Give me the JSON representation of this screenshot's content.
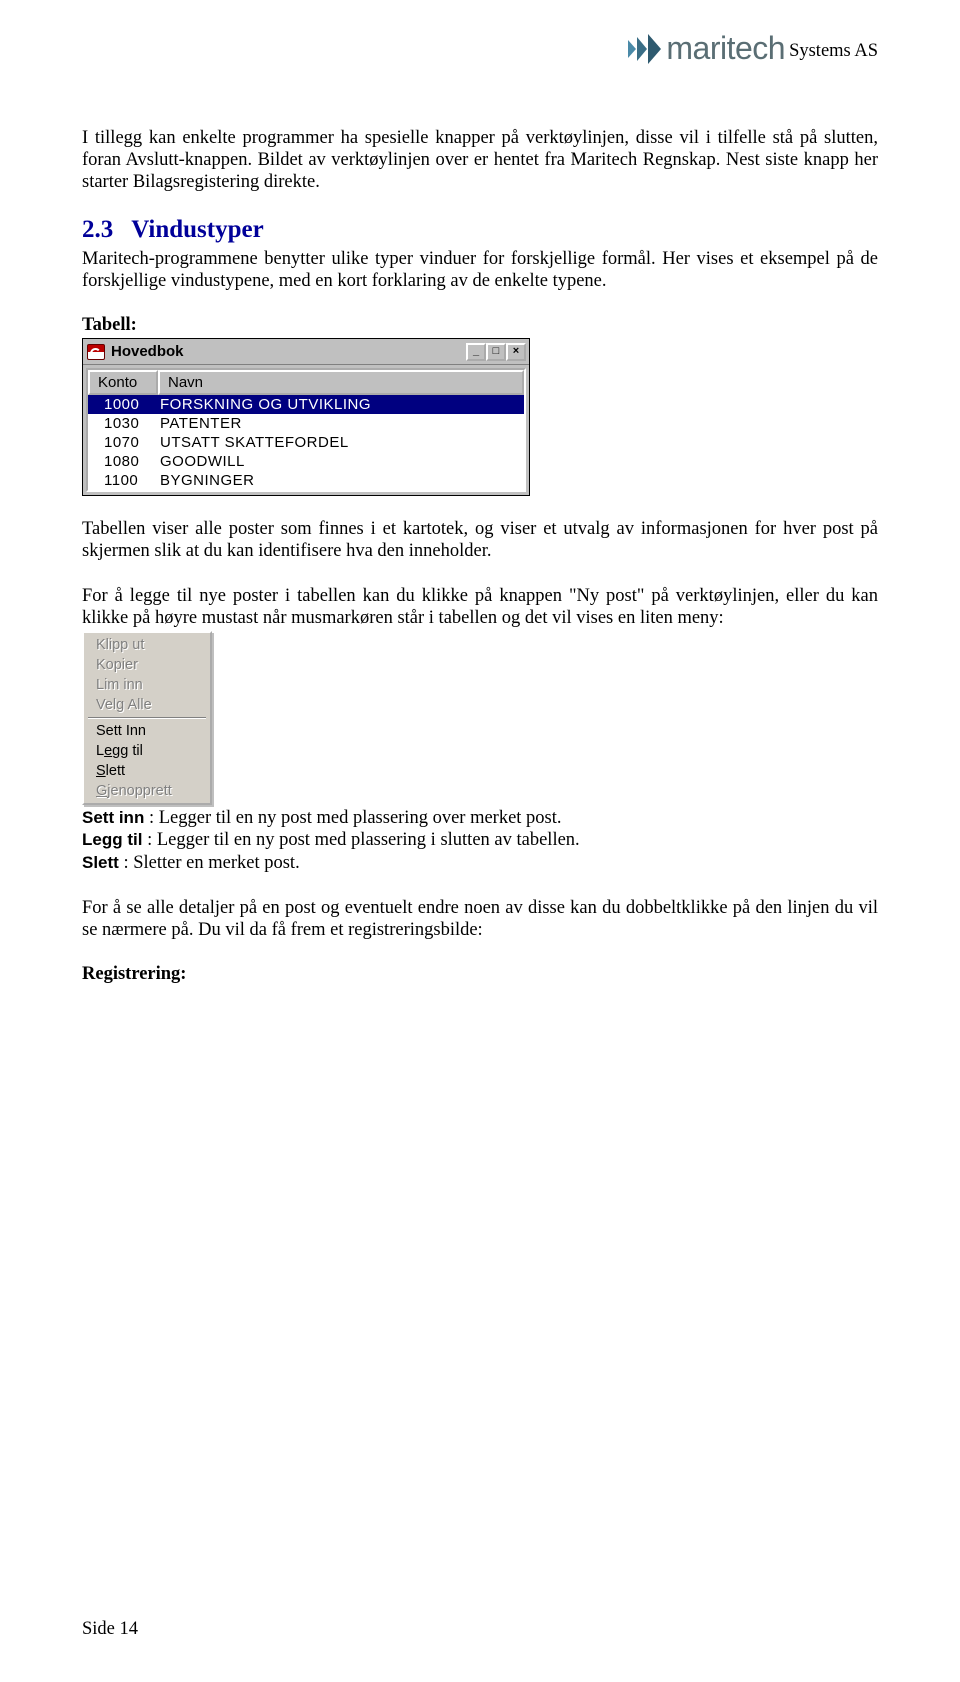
{
  "header": {
    "brand_text": "maritech",
    "brand_suffix": "Systems AS"
  },
  "para1": "I tillegg kan enkelte programmer ha spesielle knapper på verktøylinjen, disse vil i tilfelle stå på slutten, foran Avslutt-knappen. Bildet av verktøylinjen over er hentet fra Maritech Regnskap. Nest siste knapp her starter Bilagsregistering direkte.",
  "section": {
    "num": "2.3",
    "title": "Vindustyper"
  },
  "para2": "Maritech-programmene benytter ulike typer vinduer for forskjellige formål. Her vises et eksempel på de forskjellige vindustypene, med en kort forklaring av de enkelte typene.",
  "tabell_label": "Tabell:",
  "hovedbok": {
    "title": "Hovedbok",
    "col_konto": "Konto",
    "col_navn": "Navn",
    "rows": [
      {
        "konto": "1000",
        "navn": "FORSKNING OG UTVIKLING",
        "selected": true
      },
      {
        "konto": "1030",
        "navn": "PATENTER",
        "selected": false
      },
      {
        "konto": "1070",
        "navn": "UTSATT SKATTEFORDEL",
        "selected": false
      },
      {
        "konto": "1080",
        "navn": "GOODWILL",
        "selected": false
      },
      {
        "konto": "1100",
        "navn": "BYGNINGER",
        "selected": false
      }
    ],
    "minbtn": "_",
    "maxbtn": "□",
    "closebtn": "×"
  },
  "para3": "Tabellen viser alle poster som finnes i et kartotek, og viser et utvalg av informasjonen for hver post på skjermen slik at du kan identifisere hva den inneholder.",
  "para4": "For å legge til nye poster i tabellen kan du klikke på knappen \"Ny post\" på verktøylinjen, eller du kan klikke på høyre mustast når musmarkøren står i tabellen og det vil vises en liten meny:",
  "menu": {
    "klipp_ut": "Klipp ut",
    "kopier": "Kopier",
    "lim_inn": "Lim inn",
    "velg_alle": "Velg Alle",
    "sett_inn": "Sett Inn",
    "legg_til": "Legg til",
    "slett": "Slett",
    "gjenopprett": "Gjenopprett"
  },
  "defs": {
    "sett_inn_label": "Sett inn",
    "sett_inn_text": " : Legger til en ny post med plassering over merket post.",
    "legg_til_label": "Legg til",
    "legg_til_text": " : Legger til en ny post med plassering i slutten av tabellen.",
    "slett_label": "Slett",
    "slett_text": " : Sletter en merket post."
  },
  "para5": "For å se alle detaljer på en post og eventuelt endre noen av disse kan du dobbeltklikke på den linjen du vil se nærmere på. Du vil da få frem et registreringsbilde:",
  "reg_label": "Registrering:",
  "footer": "Side 14"
}
